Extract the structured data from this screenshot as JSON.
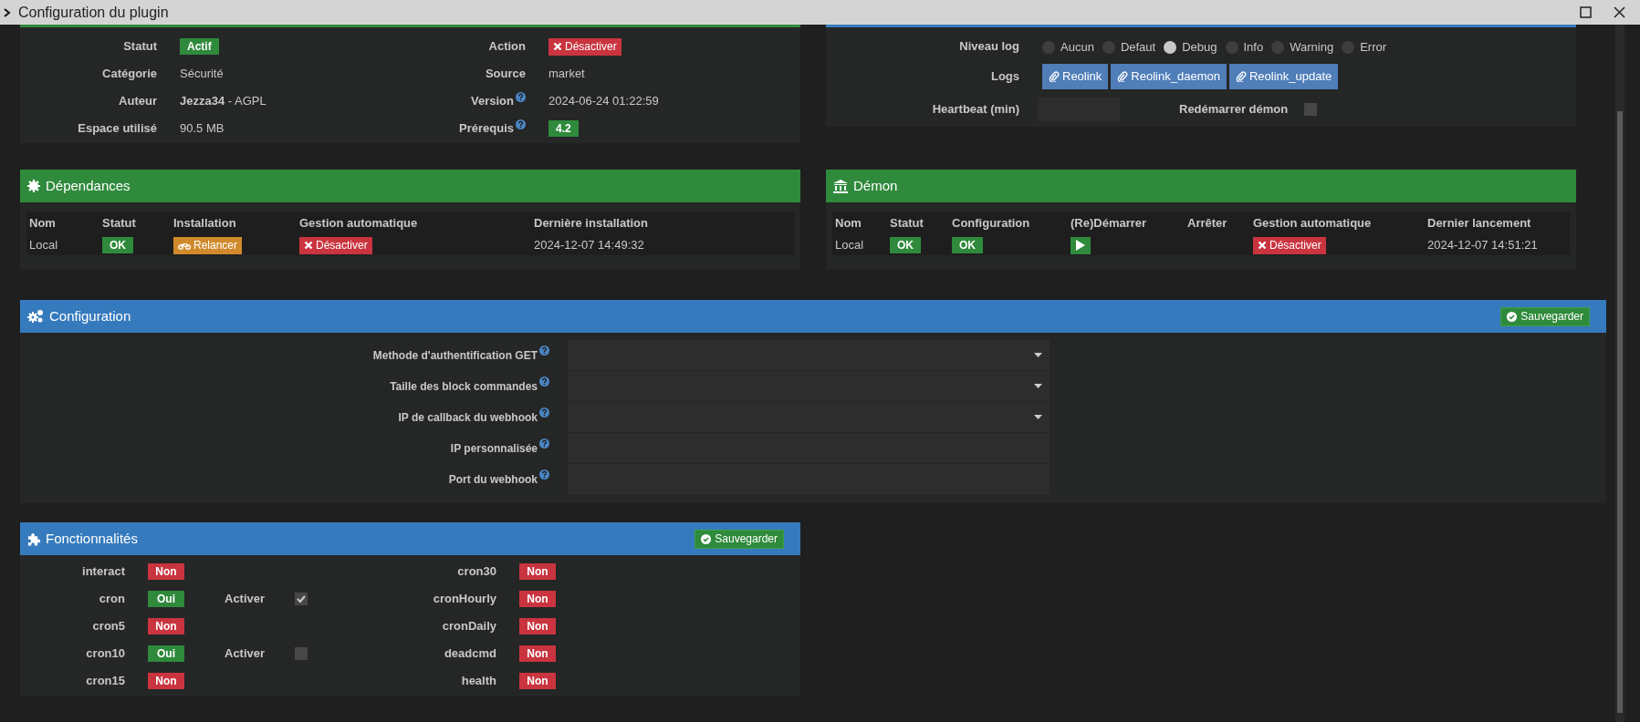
{
  "window": {
    "title": "Configuration du plugin"
  },
  "plugin_info": {
    "left": [
      {
        "label": "Statut",
        "kind": "badge",
        "value": "Actif",
        "active": true
      },
      {
        "label": "Catégorie",
        "kind": "text",
        "value": "Sécurité"
      },
      {
        "label": "Auteur",
        "kind": "text",
        "value": "**Jezza34** - AGPL"
      },
      {
        "label": "Espace utilisé",
        "kind": "text",
        "value": "90.5 MB"
      }
    ],
    "right": [
      {
        "label": "Action",
        "kind": "button",
        "value": "Désactiver"
      },
      {
        "label": "Source",
        "kind": "text",
        "value": "market"
      },
      {
        "label": "Version",
        "kind": "text",
        "value": "2024-06-24 01:22:59",
        "help": true
      },
      {
        "label": "Prérequis",
        "kind": "badge",
        "value": "4.2",
        "active": true,
        "help": true
      }
    ]
  },
  "log_panel": {
    "level_label": "Niveau log",
    "levels": [
      {
        "label": "Aucun",
        "selected": false
      },
      {
        "label": "Defaut",
        "selected": false
      },
      {
        "label": "Debug",
        "selected": true
      },
      {
        "label": "Info",
        "selected": false
      },
      {
        "label": "Warning",
        "selected": false
      },
      {
        "label": "Error",
        "selected": false
      }
    ],
    "logs_label": "Logs",
    "logs": [
      "Reolink",
      "Reolink_daemon",
      "Reolink_update"
    ],
    "heartbeat_label": "Heartbeat (min)",
    "restart_label": "Redémarrer démon",
    "restart_checked": false
  },
  "dependencies": {
    "title": "Dépendances",
    "columns": [
      "Nom",
      "Statut",
      "Installation",
      "Gestion automatique",
      "Dernière installation"
    ],
    "row": {
      "name": "Local",
      "status": "OK",
      "install_button": "Relancer",
      "auto_button": "Désactiver",
      "date": "2024-12-07 14:49:32"
    }
  },
  "daemon": {
    "title": "Démon",
    "columns": [
      "Nom",
      "Statut",
      "Configuration",
      "(Re)Démarrer",
      "Arrêter",
      "Gestion automatique",
      "Dernier lancement"
    ],
    "row": {
      "name": "Local",
      "status": "OK",
      "config": "OK",
      "auto_button": "Désactiver",
      "date": "2024-12-07 14:51:21"
    }
  },
  "configuration": {
    "title": "Configuration",
    "save_button": "Sauvegarder",
    "fields": [
      {
        "label": "Methode d'authentification GET",
        "kind": "select"
      },
      {
        "label": "Taille des block commandes",
        "kind": "select"
      },
      {
        "label": "IP de callback du webhook",
        "kind": "select"
      },
      {
        "label": "IP personnalisée",
        "kind": "text"
      },
      {
        "label": "Port du webhook",
        "kind": "text"
      }
    ]
  },
  "features": {
    "title": "Fonctionnalités",
    "save_button": "Sauvegarder",
    "left": [
      {
        "name": "interact",
        "value": "Non",
        "enabled": false
      },
      {
        "name": "cron",
        "value": "Oui",
        "enabled": true,
        "toggle": {
          "label": "Activer",
          "checked": true
        }
      },
      {
        "name": "cron5",
        "value": "Non",
        "enabled": false
      },
      {
        "name": "cron10",
        "value": "Oui",
        "enabled": true,
        "toggle": {
          "label": "Activer",
          "checked": false
        }
      },
      {
        "name": "cron15",
        "value": "Non",
        "enabled": false
      }
    ],
    "right": [
      {
        "name": "cron30",
        "value": "Non",
        "enabled": false
      },
      {
        "name": "cronHourly",
        "value": "Non",
        "enabled": false
      },
      {
        "name": "cronDaily",
        "value": "Non",
        "enabled": false
      },
      {
        "name": "deadcmd",
        "value": "Non",
        "enabled": false
      },
      {
        "name": "health",
        "value": "Non",
        "enabled": false
      }
    ]
  }
}
